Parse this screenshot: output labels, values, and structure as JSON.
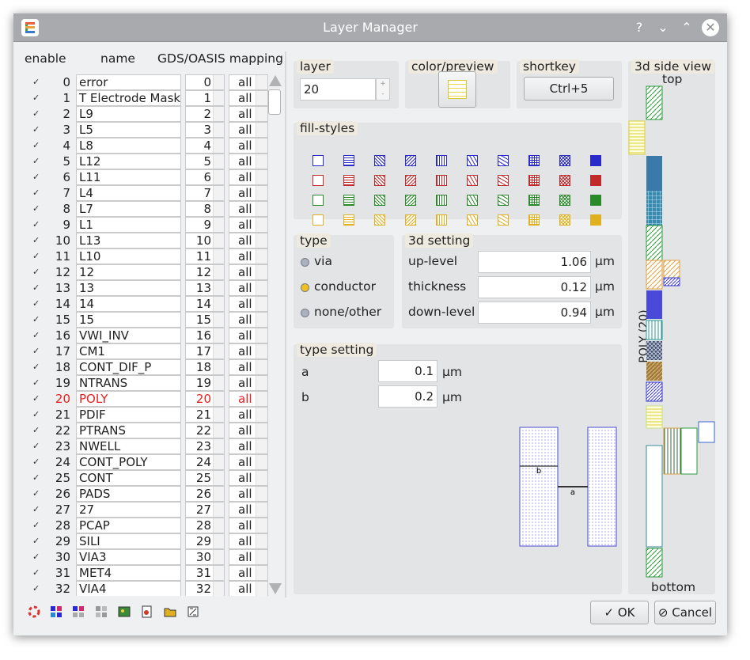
{
  "window": {
    "title": "Layer Manager",
    "help_glyph": "?",
    "min_glyph": "⌄",
    "max_glyph": "⌃",
    "close_glyph": "✕"
  },
  "list": {
    "headers": {
      "enable": "enable",
      "name": "name",
      "gds": "GDS/OASIS mapping"
    },
    "check_glyph": "✓",
    "rows": [
      {
        "num": "0",
        "name": "error",
        "gds": "0",
        "map": "all"
      },
      {
        "num": "1",
        "name": "T Electrode Mask",
        "gds": "1",
        "map": "all"
      },
      {
        "num": "2",
        "name": "L9",
        "gds": "2",
        "map": "all"
      },
      {
        "num": "3",
        "name": "L5",
        "gds": "3",
        "map": "all"
      },
      {
        "num": "4",
        "name": "L8",
        "gds": "4",
        "map": "all"
      },
      {
        "num": "5",
        "name": "L12",
        "gds": "5",
        "map": "all"
      },
      {
        "num": "6",
        "name": "L11",
        "gds": "6",
        "map": "all"
      },
      {
        "num": "7",
        "name": "L4",
        "gds": "7",
        "map": "all"
      },
      {
        "num": "8",
        "name": "L7",
        "gds": "8",
        "map": "all"
      },
      {
        "num": "9",
        "name": "L1",
        "gds": "9",
        "map": "all"
      },
      {
        "num": "10",
        "name": "L13",
        "gds": "10",
        "map": "all"
      },
      {
        "num": "11",
        "name": "L10",
        "gds": "11",
        "map": "all"
      },
      {
        "num": "12",
        "name": "12",
        "gds": "12",
        "map": "all"
      },
      {
        "num": "13",
        "name": "13",
        "gds": "13",
        "map": "all"
      },
      {
        "num": "14",
        "name": "14",
        "gds": "14",
        "map": "all"
      },
      {
        "num": "15",
        "name": "15",
        "gds": "15",
        "map": "all"
      },
      {
        "num": "16",
        "name": "VWI_INV",
        "gds": "16",
        "map": "all"
      },
      {
        "num": "17",
        "name": "CM1",
        "gds": "17",
        "map": "all"
      },
      {
        "num": "18",
        "name": "CONT_DIF_P",
        "gds": "18",
        "map": "all"
      },
      {
        "num": "19",
        "name": "NTRANS",
        "gds": "19",
        "map": "all"
      },
      {
        "num": "20",
        "name": "POLY",
        "gds": "20",
        "map": "all",
        "selected": true
      },
      {
        "num": "21",
        "name": "PDIF",
        "gds": "21",
        "map": "all"
      },
      {
        "num": "22",
        "name": "PTRANS",
        "gds": "22",
        "map": "all"
      },
      {
        "num": "23",
        "name": "NWELL",
        "gds": "23",
        "map": "all"
      },
      {
        "num": "24",
        "name": "CONT_POLY",
        "gds": "24",
        "map": "all"
      },
      {
        "num": "25",
        "name": "CONT",
        "gds": "25",
        "map": "all"
      },
      {
        "num": "26",
        "name": "PADS",
        "gds": "26",
        "map": "all"
      },
      {
        "num": "27",
        "name": "27",
        "gds": "27",
        "map": "all"
      },
      {
        "num": "28",
        "name": "PCAP",
        "gds": "28",
        "map": "all"
      },
      {
        "num": "29",
        "name": "SILI",
        "gds": "29",
        "map": "all"
      },
      {
        "num": "30",
        "name": "VIA3",
        "gds": "30",
        "map": "all"
      },
      {
        "num": "31",
        "name": "MET4",
        "gds": "31",
        "map": "all"
      },
      {
        "num": "32",
        "name": "VIA4",
        "gds": "32",
        "map": "all"
      }
    ]
  },
  "layer": {
    "title": "layer",
    "value": "20",
    "spin_up": "+",
    "spin_down": "-"
  },
  "color": {
    "title": "color/preview",
    "swatch_color": "#f0e04a"
  },
  "shortkey": {
    "title": "shortkey",
    "value": "Ctrl+5"
  },
  "fill": {
    "title": "fill-styles",
    "row_colors": [
      "#2a2ac8",
      "#c02a2a",
      "#2a8a2a",
      "#e0b020"
    ]
  },
  "type": {
    "title": "type",
    "options": [
      "via",
      "conductor",
      "none/other"
    ],
    "selected": "conductor"
  },
  "setting3d": {
    "title": "3d setting",
    "unit": "µm",
    "rows": [
      {
        "label": "up-level",
        "value": "1.06"
      },
      {
        "label": "thickness",
        "value": "0.12"
      },
      {
        "label": "down-level",
        "value": "0.94"
      }
    ]
  },
  "typesetting": {
    "title": "type setting",
    "unit": "µm",
    "rows": [
      {
        "label": "a",
        "value": "0.1"
      },
      {
        "label": "b",
        "value": "0.2"
      }
    ],
    "diagram_labels": {
      "a": "a",
      "b": "b"
    }
  },
  "side": {
    "title": "3d side view",
    "top": "top",
    "bottom": "bottom",
    "layer_label": "POLY (20)"
  },
  "buttons": {
    "ok": "OK",
    "cancel": "Cancel",
    "ok_icon": "✓",
    "cancel_icon": "⊘"
  },
  "toolbar_icons": [
    "lifebuoy-icon",
    "palette-icon",
    "palette-alt-icon",
    "grid-icon",
    "image-icon",
    "document-icon",
    "folder-open-icon",
    "settings-icon"
  ]
}
